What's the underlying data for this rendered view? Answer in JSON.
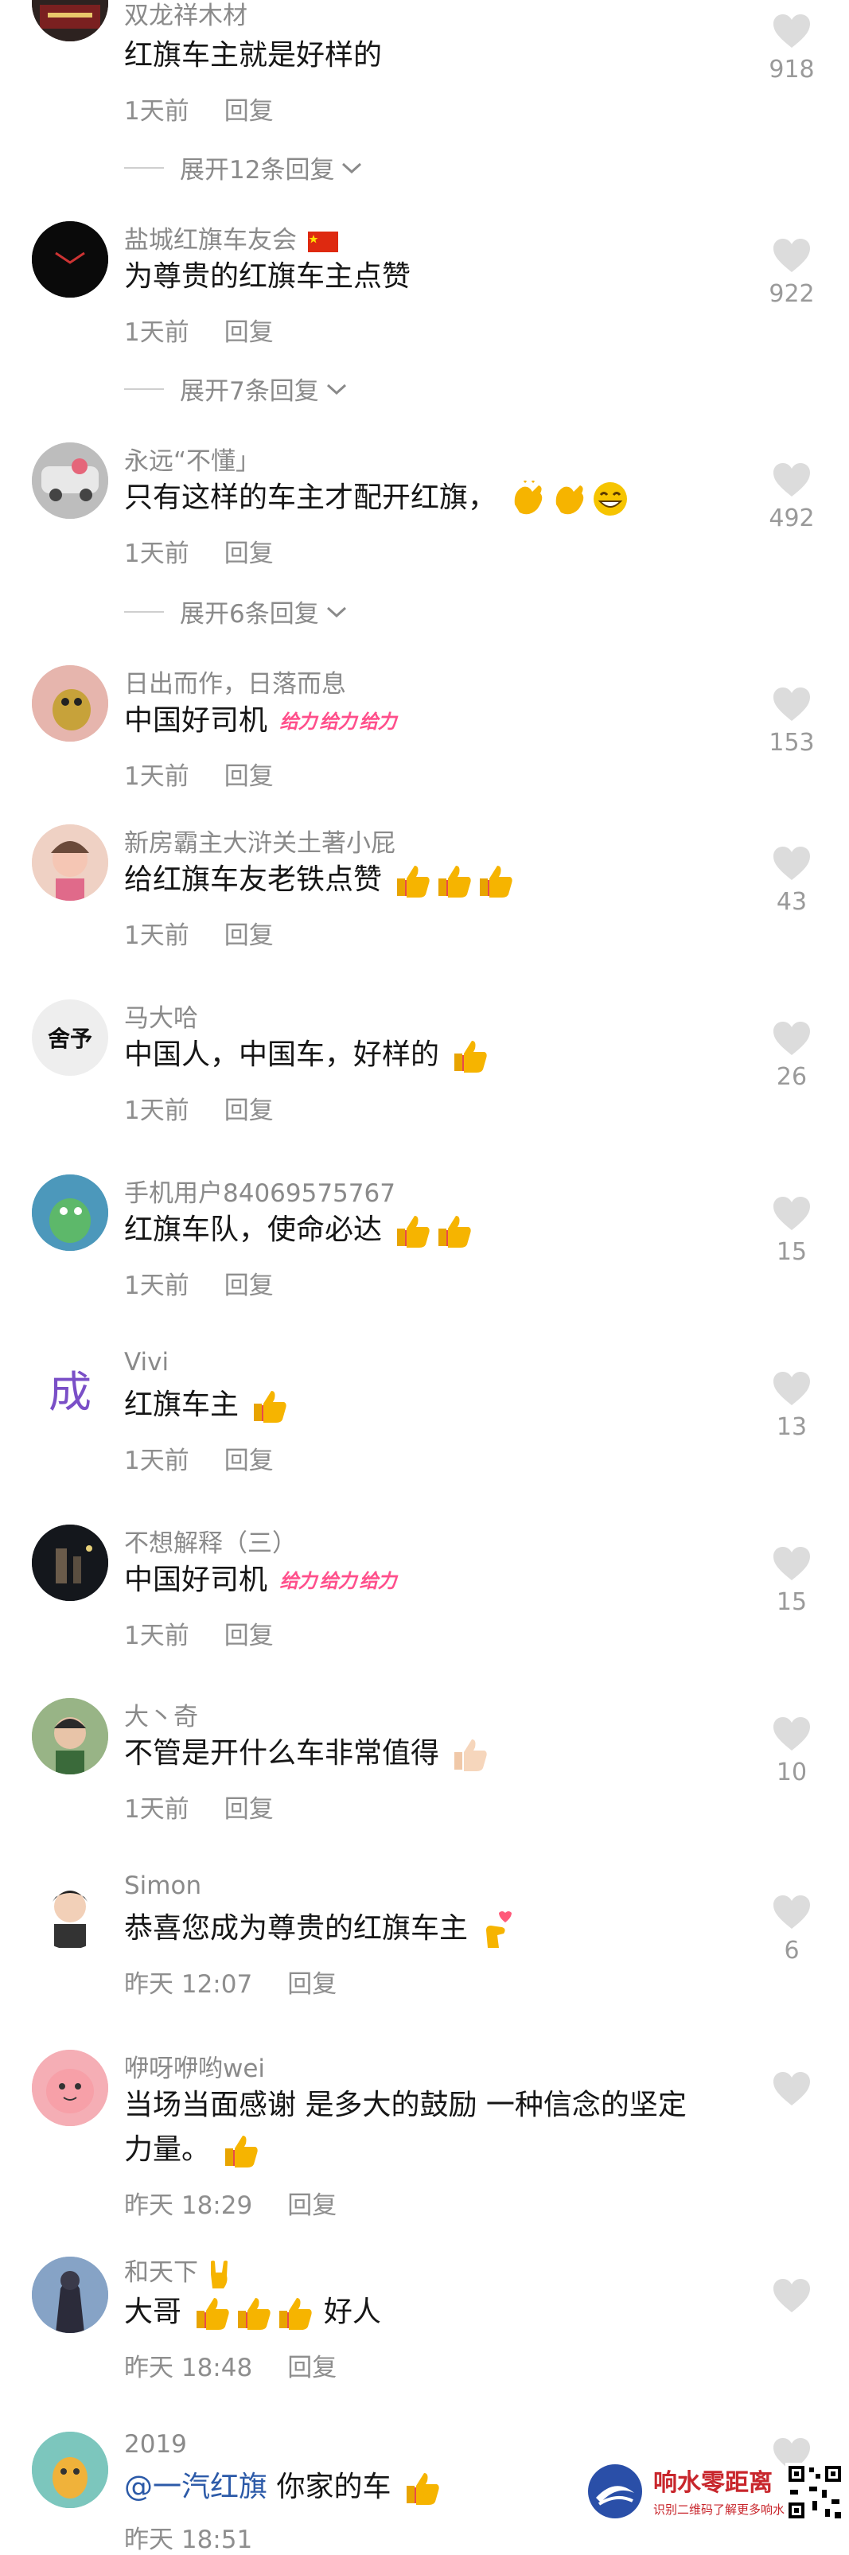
{
  "comments": [
    {
      "user": "双龙祥木材",
      "text": "红旗车主就是好样的",
      "time": "1天前",
      "reply": "回复",
      "likes": "918",
      "expand": "展开12条回复"
    },
    {
      "user": "盐城红旗车友会",
      "text": "为尊贵的红旗车主点赞",
      "time": "1天前",
      "reply": "回复",
      "likes": "922",
      "expand": "展开7条回复"
    },
    {
      "user": "永远“不懂」",
      "text": "只有这样的车主才配开红旗，",
      "time": "1天前",
      "reply": "回复",
      "likes": "492",
      "expand": "展开6条回复"
    },
    {
      "user": "日出而作，日落而息",
      "text": "中国好司机",
      "time": "1天前",
      "reply": "回复",
      "likes": "153"
    },
    {
      "user": "新房霸主大浒关土著小屁",
      "text": "给红旗车友老铁点赞",
      "time": "1天前",
      "reply": "回复",
      "likes": "43"
    },
    {
      "user": "马大哈",
      "text": "中国人，中国车，好样的",
      "time": "1天前",
      "reply": "回复",
      "likes": "26",
      "avatar_text": "舍予"
    },
    {
      "user": "手机用户84069575767",
      "text": "红旗车队，使命必达",
      "time": "1天前",
      "reply": "回复",
      "likes": "15"
    },
    {
      "user": "Vivi",
      "text": "红旗车主",
      "time": "1天前",
      "reply": "回复",
      "likes": "13",
      "avatar_text": "成"
    },
    {
      "user": "不想解释（三）",
      "text": "中国好司机",
      "time": "1天前",
      "reply": "回复",
      "likes": "15"
    },
    {
      "user": "大丶奇",
      "text": "不管是开什么车非常值得",
      "time": "1天前",
      "reply": "回复",
      "likes": "10"
    },
    {
      "user": "Simon",
      "text": "恭喜您成为尊贵的红旗车主",
      "time": "昨天 12:07",
      "reply": "回复",
      "likes": "6"
    },
    {
      "user": "咿呀咿哟wei",
      "text": "当场当面感谢 是多大的鼓励 一种信念的坚定力量。",
      "time": "昨天 18:29",
      "reply": "回复",
      "likes": ""
    },
    {
      "user": "和天下",
      "text": "大哥",
      "text2": "好人",
      "time": "昨天 18:48",
      "reply": "回复",
      "likes": ""
    },
    {
      "user": "2019",
      "mention": "@一汽红旗",
      "text": " 你家的车",
      "time": "昨天 18:51",
      "reply": "",
      "likes": ""
    }
  ],
  "jiayou_label": "给力",
  "watermark": {
    "title": "响水零距离",
    "subtitle": "识别二维码了解更多响水事"
  },
  "colors": {
    "meta": "#8e8e8e",
    "mention": "#2c5aa8",
    "jiayou": "#ff4f8b",
    "thumb": "#f6b400"
  }
}
